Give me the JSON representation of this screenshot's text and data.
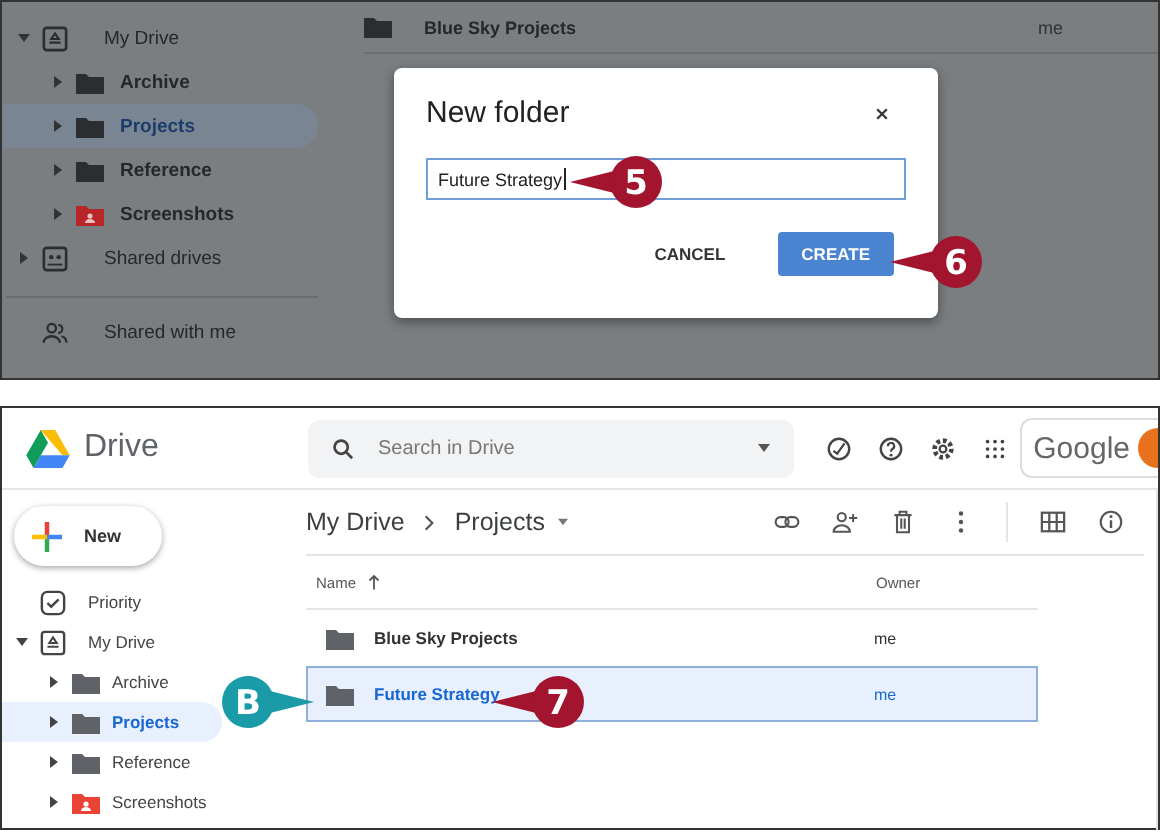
{
  "top_panel": {
    "sidebar": {
      "tree": [
        {
          "label": "My Drive",
          "kind": "drive",
          "expanded": true,
          "selected": false,
          "children": [
            {
              "label": "Archive",
              "kind": "folder",
              "expanded": false,
              "selected": false
            },
            {
              "label": "Projects",
              "kind": "folder",
              "expanded": false,
              "selected": true
            },
            {
              "label": "Reference",
              "kind": "folder",
              "expanded": false,
              "selected": false
            },
            {
              "label": "Screenshots",
              "kind": "shared-folder",
              "expanded": false,
              "selected": false
            }
          ]
        },
        {
          "label": "Shared drives",
          "kind": "shared-drives",
          "expanded": false,
          "selected": false
        }
      ],
      "links": [
        {
          "label": "Shared with me",
          "kind": "shared"
        }
      ]
    },
    "file_row": {
      "name": "Blue Sky Projects",
      "owner": "me"
    },
    "dialog": {
      "title": "New folder",
      "value": "Future Strategy",
      "buttons": [
        {
          "label": "CANCEL",
          "kind": "text"
        },
        {
          "label": "CREATE",
          "kind": "primary"
        }
      ]
    },
    "callouts": [
      {
        "label": "5",
        "kind": "point-left",
        "color": "#a3152f"
      },
      {
        "label": "6",
        "kind": "point-left",
        "color": "#a3152f"
      }
    ]
  },
  "bottom_panel": {
    "header": {
      "app_name": "Drive",
      "search": {
        "placeholder": "Search in Drive"
      },
      "account": "Google"
    },
    "sidebar": {
      "new_button": "New",
      "nav": [
        {
          "label": "Priority",
          "kind": "priority",
          "selected": false
        },
        {
          "label": "My Drive",
          "kind": "drive",
          "expanded": true,
          "selected": false,
          "children": [
            {
              "label": "Archive",
              "kind": "folder",
              "expanded": false,
              "selected": false
            },
            {
              "label": "Projects",
              "kind": "folder",
              "expanded": false,
              "selected": true
            },
            {
              "label": "Reference",
              "kind": "folder",
              "expanded": false,
              "selected": false
            },
            {
              "label": "Screenshots",
              "kind": "shared-folder",
              "expanded": false,
              "selected": false
            }
          ]
        }
      ]
    },
    "breadcrumb": [
      "My Drive",
      "Projects"
    ],
    "table": {
      "columns": [
        "Name",
        "Owner"
      ],
      "rows": [
        {
          "name": "Blue Sky Projects",
          "owner": "me",
          "selected": false
        },
        {
          "name": "Future Strategy",
          "owner": "me",
          "selected": true
        }
      ]
    },
    "callouts": [
      {
        "label": "B",
        "kind": "point-right",
        "color": "#1b9aa8"
      },
      {
        "label": "7",
        "kind": "point-left",
        "color": "#a3152f"
      }
    ]
  }
}
